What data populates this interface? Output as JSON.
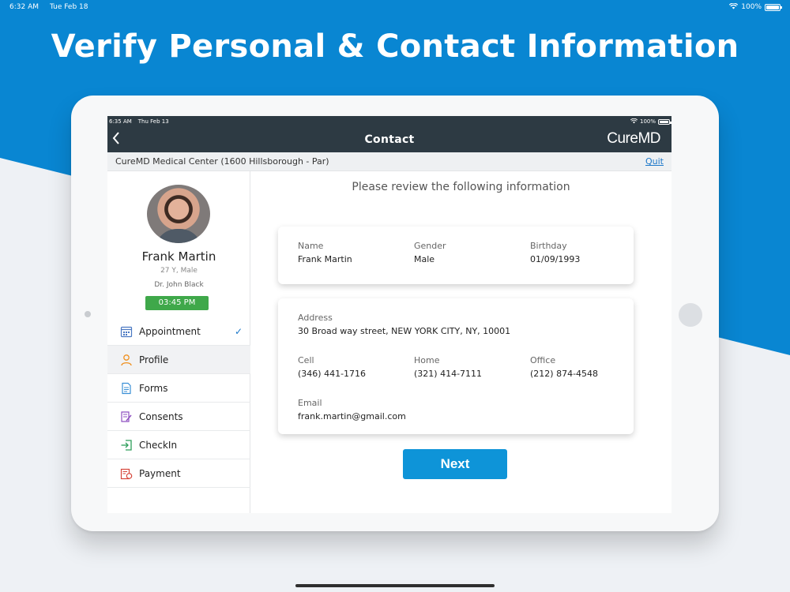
{
  "outer_status": {
    "time": "6:32 AM",
    "date": "Tue Feb 18",
    "battery": "100%"
  },
  "headline": "Verify Personal & Contact Information",
  "inner_status": {
    "time": "6:35 AM",
    "date": "Thu Feb 13",
    "battery": "100%"
  },
  "header": {
    "title": "Contact",
    "logo": "CureMD",
    "back_icon": "chevron-left-icon"
  },
  "location": {
    "text": "CureMD Medical Center (1600 Hillsborough - Par)",
    "quit": "Quit"
  },
  "patient": {
    "name": "Frank Martin",
    "age_gender": "27 Y, Male",
    "doctor": "Dr. John Black",
    "time": "03:45 PM"
  },
  "menu": [
    {
      "label": "Appointment",
      "icon": "calendar-icon",
      "checked": true
    },
    {
      "label": "Profile",
      "icon": "user-icon"
    },
    {
      "label": "Forms",
      "icon": "document-icon"
    },
    {
      "label": "Consents",
      "icon": "consent-icon"
    },
    {
      "label": "CheckIn",
      "icon": "checkin-icon"
    },
    {
      "label": "Payment",
      "icon": "payment-icon"
    }
  ],
  "main": {
    "title": "Please review the following information",
    "personal": {
      "name_label": "Name",
      "name": "Frank Martin",
      "gender_label": "Gender",
      "gender": "Male",
      "birthday_label": "Birthday",
      "birthday": "01/09/1993"
    },
    "contact": {
      "address_label": "Address",
      "address": "30 Broad way street, NEW YORK CITY, NY, 10001",
      "cell_label": "Cell",
      "cell": "(346) 441-1716",
      "home_label": "Home",
      "home": "(321) 414-7111",
      "office_label": "Office",
      "office": "(212) 874-4548",
      "email_label": "Email",
      "email": "frank.martin@gmail.com"
    },
    "next_label": "Next"
  },
  "colors": {
    "accent": "#0e94d8",
    "header_bg": "#2d3a43",
    "time_badge": "#3fa84a",
    "background_blue": "#0986d2"
  }
}
